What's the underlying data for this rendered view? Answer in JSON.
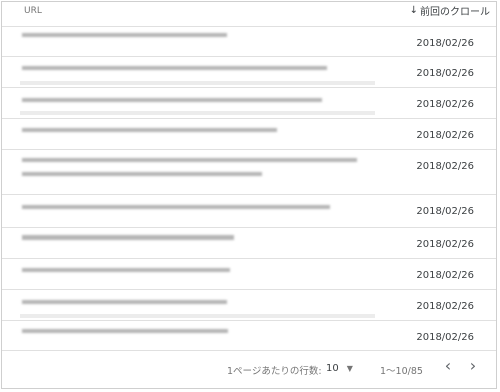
{
  "header": {
    "url_label": "URL",
    "sort_icon": "↓",
    "sort_label": "前回のクロール"
  },
  "rows": [
    {
      "date": "2018/02/26"
    },
    {
      "date": "2018/02/26"
    },
    {
      "date": "2018/02/26"
    },
    {
      "date": "2018/02/26"
    },
    {
      "date": "2018/02/26"
    },
    {
      "date": "2018/02/26"
    },
    {
      "date": "2018/02/26"
    },
    {
      "date": "2018/02/26"
    },
    {
      "date": "2018/02/26"
    },
    {
      "date": "2018/02/26"
    }
  ],
  "pagination": {
    "rows_per_page_label": "1ページあたりの行数:",
    "rows_per_page_value": "10",
    "dropdown_icon": "▼",
    "range": "1〜10/85",
    "prev_icon": "‹",
    "next_icon": "›"
  }
}
